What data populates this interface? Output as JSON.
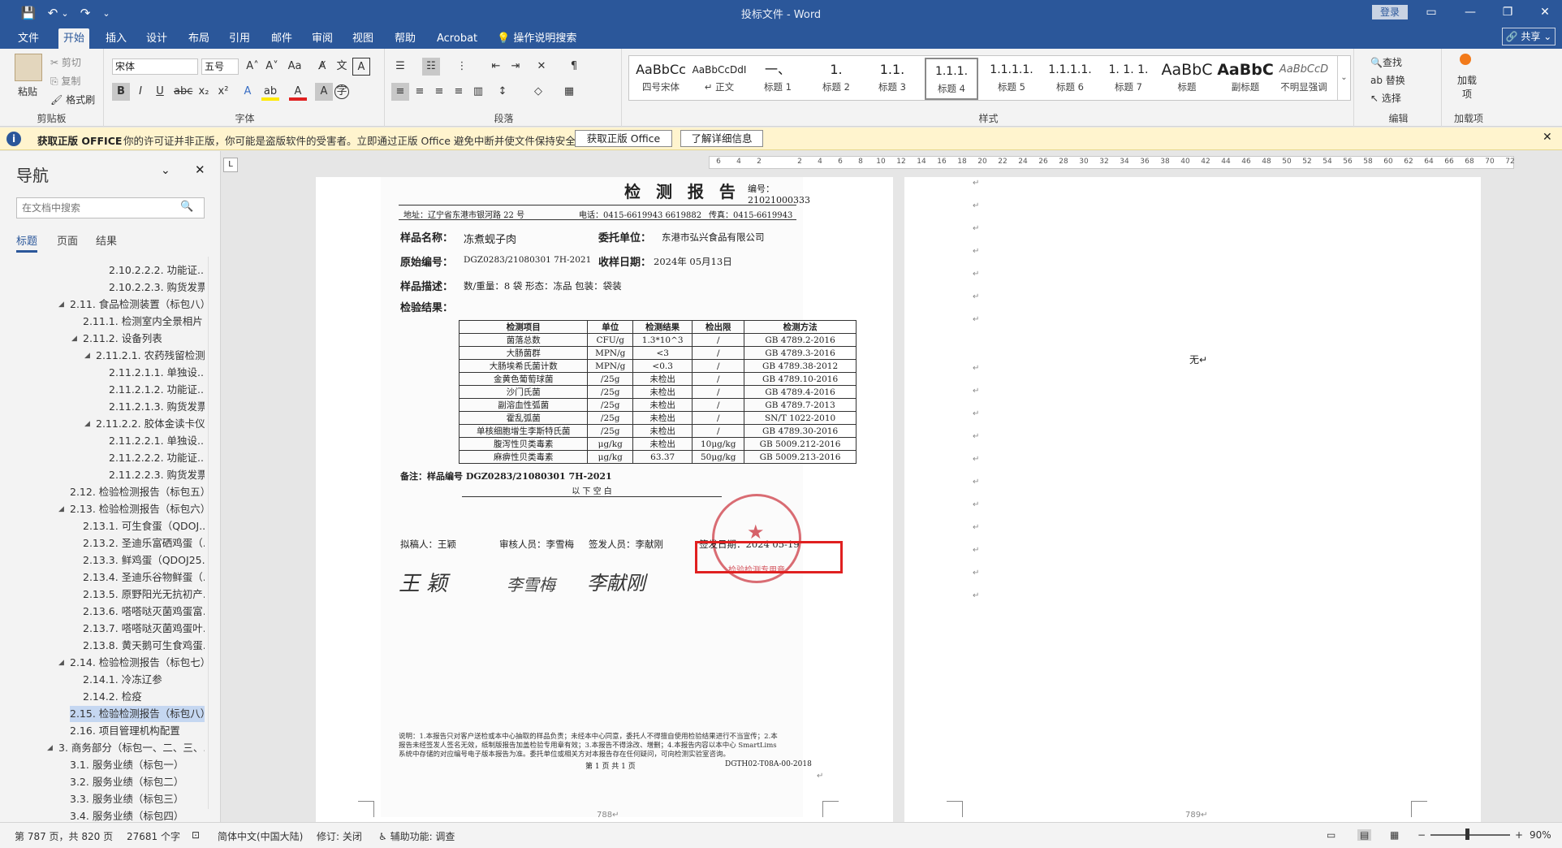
{
  "titlebar": {
    "title": "投标文件 - Word",
    "login": "登录",
    "qa_save": "💾",
    "qa_undo": "↶",
    "qa_undo_drop": "⌄",
    "qa_redo": "↷",
    "qa_customize": "⌄"
  },
  "tabs": [
    {
      "label": "文件"
    },
    {
      "label": "开始"
    },
    {
      "label": "插入"
    },
    {
      "label": "设计"
    },
    {
      "label": "布局"
    },
    {
      "label": "引用"
    },
    {
      "label": "邮件"
    },
    {
      "label": "审阅"
    },
    {
      "label": "视图"
    },
    {
      "label": "帮助"
    },
    {
      "label": "Acrobat"
    },
    {
      "label": "操作说明搜索"
    }
  ],
  "share": "🔗 共享 ⌄",
  "ribbon": {
    "clipboard": {
      "label": "剪贴板",
      "paste": "粘贴",
      "cut": "剪切",
      "copy": "复制",
      "format_painter": "格式刷"
    },
    "font": {
      "label": "字体",
      "name": "宋体",
      "size": "五号"
    },
    "paragraph": {
      "label": "段落"
    },
    "styles": {
      "label": "样式",
      "items": [
        {
          "preview": "AaBbCc",
          "name": "四号宋体"
        },
        {
          "preview": "AaBbCcDdI",
          "name": "↵ 正文"
        },
        {
          "preview": "一、",
          "name": "标题 1"
        },
        {
          "preview": "1.",
          "name": "标题 2"
        },
        {
          "preview": "1.1.",
          "name": "标题 3"
        },
        {
          "preview": "1.1.1.",
          "name": "标题 4"
        },
        {
          "preview": "1.1.1.1.",
          "name": "标题 5"
        },
        {
          "preview": "1.1.1.1.",
          "name": "标题 6"
        },
        {
          "preview": "1. 1. 1.",
          "name": "标题 7"
        },
        {
          "preview": "AaBbC",
          "name": "标题"
        },
        {
          "preview": "AaBbC",
          "name": "副标题"
        },
        {
          "preview": "AaBbCcD",
          "name": "不明显强调"
        }
      ]
    },
    "editing": {
      "label": "编辑",
      "find": "查找",
      "replace": "替换",
      "select": "选择"
    },
    "addins": {
      "label": "加载项",
      "btn": "加载项"
    }
  },
  "message": {
    "title": "获取正版 OFFICE",
    "text": "你的许可证并非正版，你可能是盗版软件的受害者。立即通过正版 Office 避免中断并使文件保持安全。",
    "btn_get": "获取正版 Office",
    "btn_more": "了解详细信息"
  },
  "nav": {
    "title": "导航",
    "search_placeholder": "在文档中搜索",
    "tabs": [
      "标题",
      "页面",
      "结果"
    ],
    "items": [
      {
        "text": "2.10.2.2.2. 功能证...",
        "level": 4
      },
      {
        "text": "2.10.2.2.3. 购货发票",
        "level": 4
      },
      {
        "text": "2.11. 食品检测装置（标包八）",
        "level": 1,
        "exp": true
      },
      {
        "text": "2.11.1. 检测室内全景相片",
        "level": 2
      },
      {
        "text": "2.11.2. 设备列表",
        "level": 2,
        "exp": true
      },
      {
        "text": "2.11.2.1. 农药残留检测...",
        "level": 3,
        "exp": true
      },
      {
        "text": "2.11.2.1.1. 单独设...",
        "level": 4
      },
      {
        "text": "2.11.2.1.2. 功能证...",
        "level": 4
      },
      {
        "text": "2.11.2.1.3. 购货发票",
        "level": 4
      },
      {
        "text": "2.11.2.2. 胶体金读卡仪",
        "level": 3,
        "exp": true
      },
      {
        "text": "2.11.2.2.1. 单独设...",
        "level": 4
      },
      {
        "text": "2.11.2.2.2. 功能证...",
        "level": 4
      },
      {
        "text": "2.11.2.2.3. 购货发票",
        "level": 4
      },
      {
        "text": "2.12. 检验检测报告（标包五）",
        "level": 1
      },
      {
        "text": "2.13. 检验检测报告（标包六）",
        "level": 1,
        "exp": true
      },
      {
        "text": "2.13.1. 可生食蛋（QDOJ...",
        "level": 2
      },
      {
        "text": "2.13.2. 圣迪乐富硒鸡蛋（...",
        "level": 2
      },
      {
        "text": "2.13.3. 鲜鸡蛋（QDOJ25...",
        "level": 2
      },
      {
        "text": "2.13.4. 圣迪乐谷物鲜蛋（...",
        "level": 2
      },
      {
        "text": "2.13.5. 原野阳光无抗初产...",
        "level": 2
      },
      {
        "text": "2.13.6. 嗒嗒哒灭菌鸡蛋富...",
        "level": 2
      },
      {
        "text": "2.13.7. 嗒嗒哒灭菌鸡蛋叶...",
        "level": 2
      },
      {
        "text": "2.13.8. 黄天鹅可生食鸡蛋...",
        "level": 2
      },
      {
        "text": "2.14. 检验检测报告（标包七）",
        "level": 1,
        "exp": true
      },
      {
        "text": "2.14.1. 冷冻辽参",
        "level": 2
      },
      {
        "text": "2.14.2. 检疫",
        "level": 2
      },
      {
        "text": "2.15. 检验检测报告（标包八）",
        "level": 1,
        "sel": true
      },
      {
        "text": "2.16. 项目管理机构配置",
        "level": 1
      },
      {
        "text": "3. 商务部分（标包一、二、三、...",
        "level": 0,
        "exp": true
      },
      {
        "text": "3.1. 服务业绩（标包一）",
        "level": 1
      },
      {
        "text": "3.2. 服务业绩（标包二）",
        "level": 1
      },
      {
        "text": "3.3. 服务业绩（标包三）",
        "level": 1
      },
      {
        "text": "3.4. 服务业绩（标包四）",
        "level": 1
      }
    ]
  },
  "ruler": [
    "6",
    "4",
    "2",
    "",
    "2",
    "4",
    "6",
    "8",
    "10",
    "12",
    "14",
    "16",
    "18",
    "20",
    "22",
    "24",
    "26",
    "28",
    "30",
    "32",
    "34",
    "36",
    "38",
    "40",
    "42",
    "44",
    "46",
    "48",
    "50",
    "52",
    "54",
    "56",
    "58",
    "60",
    "62",
    "64",
    "66",
    "68",
    "70",
    "72"
  ],
  "report": {
    "title": "检 测 报 告",
    "number": "编号：21021000333",
    "address": "地址：辽宁省东港市银河路 22 号",
    "phone": "电话：0415-6619943  6619882",
    "fax": "传真：0415-6619943",
    "sample_name_label": "样品名称：",
    "sample_name": "冻煮蚬子肉",
    "client_label": "委托单位：",
    "client": "东港市弘兴食品有限公司",
    "orig_no_label": "原始编号：",
    "orig_no": "DGZ0283/21080301 7H-2021",
    "recv_label": "收样日期：",
    "recv_date": "2024年  05月13日",
    "desc_label": "样品描述：",
    "desc": "数/重量：8 袋   形态：冻品   包装：袋装",
    "result_label": "检验结果：",
    "headers": [
      "检测项目",
      "单位",
      "检测结果",
      "检出限",
      "检测方法"
    ],
    "rows": [
      [
        "菌落总数",
        "CFU/g",
        "1.3*10^3",
        "/",
        "GB 4789.2-2016"
      ],
      [
        "大肠菌群",
        "MPN/g",
        "<3",
        "/",
        "GB 4789.3-2016"
      ],
      [
        "大肠埃希氏菌计数",
        "MPN/g",
        "<0.3",
        "/",
        "GB 4789.38-2012"
      ],
      [
        "金黄色葡萄球菌",
        "/25g",
        "未检出",
        "/",
        "GB 4789.10-2016"
      ],
      [
        "沙门氏菌",
        "/25g",
        "未检出",
        "/",
        "GB 4789.4-2016"
      ],
      [
        "副溶血性弧菌",
        "/25g",
        "未检出",
        "/",
        "GB 4789.7-2013"
      ],
      [
        "霍乱弧菌",
        "/25g",
        "未检出",
        "/",
        "SN/T 1022-2010"
      ],
      [
        "单核细胞增生李斯特氏菌",
        "/25g",
        "未检出",
        "/",
        "GB 4789.30-2016"
      ],
      [
        "腹泻性贝类毒素",
        "μg/kg",
        "未检出",
        "10μg/kg",
        "GB 5009.212-2016"
      ],
      [
        "麻痹性贝类毒素",
        "μg/kg",
        "63.37",
        "50μg/kg",
        "GB 5009.213-2016"
      ]
    ],
    "remark": "备注：样品编号 DGZ0283/21080301 7H-2021",
    "blank_line": "以          下          空          白",
    "drafter": "拟稿人：王颖",
    "reviewer": "审核人员：李雪梅",
    "issuer": "签发人员：李献刚",
    "issue_date": "签发日期：2024  05-19",
    "stamp_text": "检验检测专用章",
    "sig1": "王 颖",
    "sig2": "李雪梅",
    "sig3": "李献刚",
    "notes": "说明：1.本报告只对客户送检或本中心抽取的样品负责；未经本中心同意，委托人不得擅自使用检验结果进行不当宣传；2.本报告未经签发人签名无效，纸制版报告加盖检验专用章有效；3.本报告不得涂改、增删；4.本报告内容以本中心 SmartLims 系统中存储的对应编号电子版本报告为准。委托单位或相关方对本报告存在任何疑问，可向检测实验室咨询。",
    "page_footer": "第 1 页  共 1 页",
    "form_no": "DGTH02-T08A-00-2018"
  },
  "page1_number": "788↵",
  "page2_number": "789↵",
  "page2_text": "无↵",
  "para_mark": "↵",
  "status": {
    "page": "第 787 页，共 820 页",
    "words": "27681 个字",
    "lang": "简体中文(中国大陆)",
    "track": "修订: 关闭",
    "accessibility": "辅助功能: 调查",
    "zoom": "90%"
  }
}
